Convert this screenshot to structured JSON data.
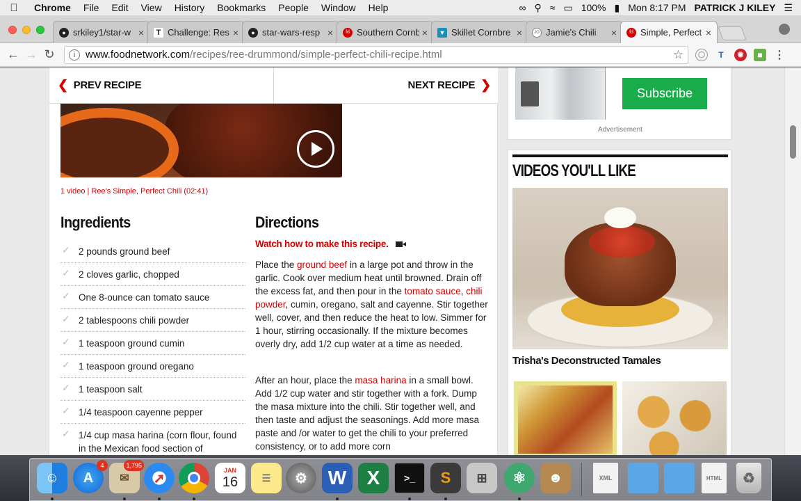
{
  "menubar": {
    "app": "Chrome",
    "items": [
      "File",
      "Edit",
      "View",
      "History",
      "Bookmarks",
      "People",
      "Window",
      "Help"
    ],
    "battery": "100%",
    "clock": "Mon 8:17 PM",
    "user": "PATRICK J KILEY"
  },
  "tabs": [
    {
      "title": "srkiley1/star-w",
      "icon": "github-icon"
    },
    {
      "title": "Challenge: Res",
      "icon": "treehouse-icon"
    },
    {
      "title": "star-wars-resp",
      "icon": "github-icon"
    },
    {
      "title": "Southern Cornb",
      "icon": "foodnetwork-icon"
    },
    {
      "title": "Skillet Cornbre",
      "icon": "bookmark-icon"
    },
    {
      "title": "Jamie's Chili",
      "icon": "site-icon"
    },
    {
      "title": "Simple, Perfect",
      "icon": "foodnetwork-icon"
    }
  ],
  "address": {
    "domain": "www.foodnetwork.com",
    "path": "/recipes/ree-drummond/simple-perfect-chili-recipe.html"
  },
  "recipe_nav": {
    "prev": "PREV RECIPE",
    "next": "NEXT RECIPE"
  },
  "video_caption": "1 video | Ree's Simple, Perfect Chili (02:41)",
  "ingredients": {
    "title": "Ingredients",
    "items": [
      "2 pounds ground beef",
      "2 cloves garlic, chopped",
      "One 8-ounce can tomato sauce",
      "2 tablespoons chili powder",
      "1 teaspoon ground cumin",
      "1 teaspoon ground oregano",
      "1 teaspoon salt",
      "1/4 teaspoon cayenne pepper",
      "1/4 cup masa harina (corn flour, found in the Mexican food section of"
    ]
  },
  "directions": {
    "title": "Directions",
    "watch": "Watch how to make this recipe.",
    "p1": {
      "a": "Place the ",
      "link1": "ground beef",
      "b": " in a large pot and throw in the garlic. Cook over medium heat until browned. Drain off the excess fat, and then pour in the ",
      "link2": "tomato sauce",
      "c": ", ",
      "link3": "chili powder",
      "d": ", cumin, oregano, salt and cayenne. Stir together well, cover, and then reduce the heat to low. Simmer for 1 hour, stirring occasionally. If the mixture becomes overly dry, add 1/2 cup water at a time as needed."
    },
    "p2": {
      "a": "After an hour, place the ",
      "link1": "masa harina",
      "b": " in a small bowl. Add 1/2 cup water and stir together with a fork. Dump the masa mixture into the chili. Stir together well, and then taste and adjust the seasonings. Add more masa paste and /or water to get the chili to your preferred consistency, or to add more corn"
    }
  },
  "sidebar": {
    "subscribe": "Subscribe",
    "ad_label": "Advertisement",
    "videos_title": "VIDEOS YOU'LL LIKE",
    "featured_caption": "Trisha's Deconstructed Tamales"
  },
  "dock": {
    "appstore_badge": "4",
    "mail_badge": "1,795",
    "calendar_month": "JAN",
    "calendar_day": "16"
  }
}
